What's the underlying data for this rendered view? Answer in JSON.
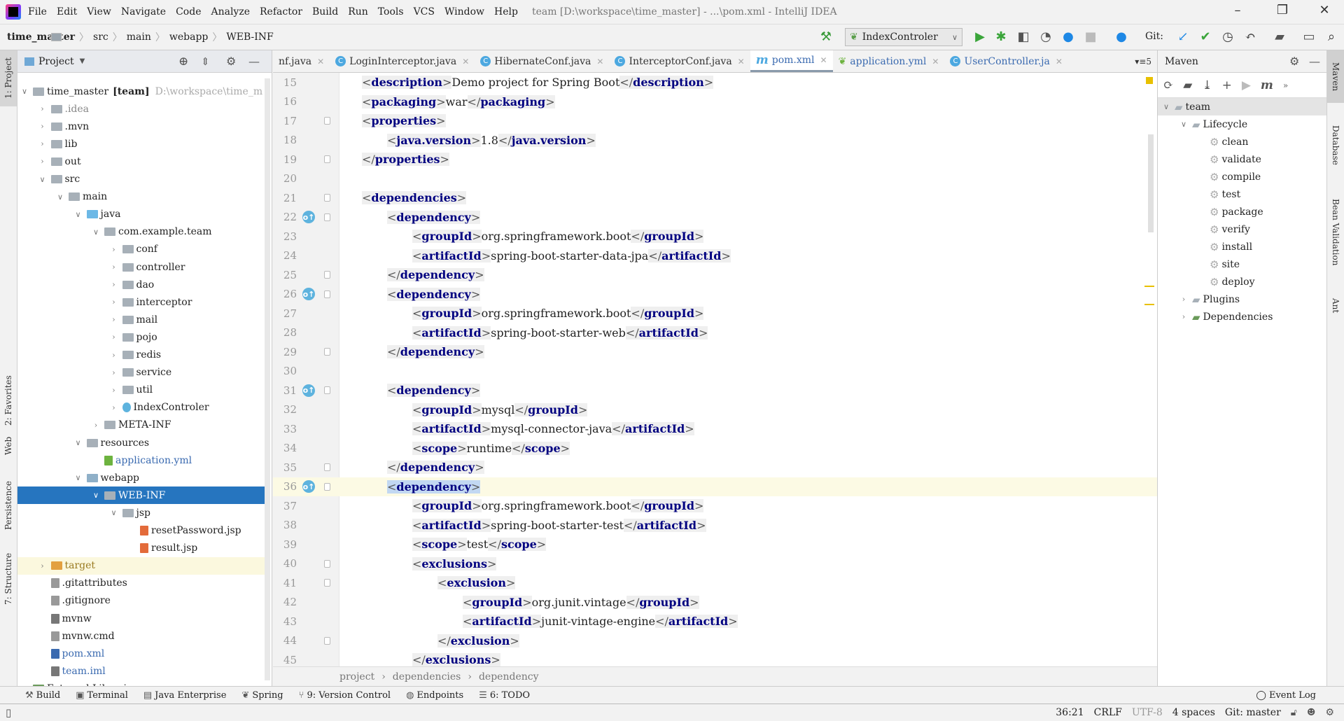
{
  "window": {
    "title": "team [D:\\workspace\\time_master] - ...\\pom.xml - IntelliJ IDEA",
    "minimize": "–",
    "restore": "❐",
    "close": "✕"
  },
  "menu": [
    "File",
    "Edit",
    "View",
    "Navigate",
    "Code",
    "Analyze",
    "Refactor",
    "Build",
    "Run",
    "Tools",
    "VCS",
    "Window",
    "Help"
  ],
  "nav": {
    "breadcrumb": [
      "time_master",
      "src",
      "main",
      "webapp",
      "WEB-INF"
    ],
    "run_config": "IndexControler",
    "git_label": "Git:"
  },
  "left_strip": [
    "1: Project",
    "2: Favorites",
    "Web",
    "Persistence",
    "7: Structure"
  ],
  "right_strip": [
    "Maven",
    "Database",
    "Bean Validation",
    "Ant"
  ],
  "project": {
    "header": "Project",
    "root_name": "time_master",
    "root_module": "[team]",
    "root_path": "D:\\workspace\\time_m",
    "items": [
      {
        "label": ".idea",
        "depth": 1,
        "exp": false,
        "icon": "folder",
        "color": "#888"
      },
      {
        "label": ".mvn",
        "depth": 1,
        "exp": false,
        "icon": "folder"
      },
      {
        "label": "lib",
        "depth": 1,
        "exp": false,
        "icon": "folder"
      },
      {
        "label": "out",
        "depth": 1,
        "exp": false,
        "icon": "folder"
      },
      {
        "label": "src",
        "depth": 1,
        "exp": true,
        "icon": "folder"
      },
      {
        "label": "main",
        "depth": 2,
        "exp": true,
        "icon": "folder"
      },
      {
        "label": "java",
        "depth": 3,
        "exp": true,
        "icon": "source-folder"
      },
      {
        "label": "com.example.team",
        "depth": 4,
        "exp": true,
        "icon": "package"
      },
      {
        "label": "conf",
        "depth": 5,
        "exp": false,
        "icon": "package"
      },
      {
        "label": "controller",
        "depth": 5,
        "exp": false,
        "icon": "package"
      },
      {
        "label": "dao",
        "depth": 5,
        "exp": false,
        "icon": "package"
      },
      {
        "label": "interceptor",
        "depth": 5,
        "exp": false,
        "icon": "package"
      },
      {
        "label": "mail",
        "depth": 5,
        "exp": false,
        "icon": "package"
      },
      {
        "label": "pojo",
        "depth": 5,
        "exp": false,
        "icon": "package"
      },
      {
        "label": "redis",
        "depth": 5,
        "exp": false,
        "icon": "package"
      },
      {
        "label": "service",
        "depth": 5,
        "exp": false,
        "icon": "package"
      },
      {
        "label": "util",
        "depth": 5,
        "exp": false,
        "icon": "package"
      },
      {
        "label": "IndexControler",
        "depth": 5,
        "exp": false,
        "icon": "spring-class"
      },
      {
        "label": "META-INF",
        "depth": 4,
        "exp": false,
        "icon": "folder"
      },
      {
        "label": "resources",
        "depth": 3,
        "exp": true,
        "icon": "resources-folder"
      },
      {
        "label": "application.yml",
        "depth": 4,
        "exp": null,
        "icon": "yml-file",
        "color": "#3a6ab0"
      },
      {
        "label": "webapp",
        "depth": 3,
        "exp": true,
        "icon": "web-folder"
      },
      {
        "label": "WEB-INF",
        "depth": 4,
        "exp": true,
        "icon": "folder",
        "state": "selected"
      },
      {
        "label": "jsp",
        "depth": 5,
        "exp": true,
        "icon": "folder"
      },
      {
        "label": "resetPassword.jsp",
        "depth": 6,
        "exp": null,
        "icon": "jsp-file"
      },
      {
        "label": "result.jsp",
        "depth": 6,
        "exp": null,
        "icon": "jsp-file"
      },
      {
        "label": "target",
        "depth": 1,
        "exp": false,
        "icon": "excluded-folder",
        "color": "#9a7a20",
        "state": "highlight"
      },
      {
        "label": ".gitattributes",
        "depth": 1,
        "exp": null,
        "icon": "file"
      },
      {
        "label": ".gitignore",
        "depth": 1,
        "exp": null,
        "icon": "file"
      },
      {
        "label": "mvnw",
        "depth": 1,
        "exp": null,
        "icon": "script-file"
      },
      {
        "label": "mvnw.cmd",
        "depth": 1,
        "exp": null,
        "icon": "file"
      },
      {
        "label": "pom.xml",
        "depth": 1,
        "exp": null,
        "icon": "maven-file",
        "color": "#3a6ab0"
      },
      {
        "label": "team.iml",
        "depth": 1,
        "exp": null,
        "icon": "iml-file",
        "color": "#3a6ab0"
      },
      {
        "label": "External Libraries",
        "depth": 0,
        "exp": false,
        "icon": "libraries"
      }
    ]
  },
  "tabs": [
    {
      "label": "nf.java",
      "icon": ""
    },
    {
      "label": "LoginInterceptor.java",
      "icon": "C"
    },
    {
      "label": "HibernateConf.java",
      "icon": "C"
    },
    {
      "label": "InterceptorConf.java",
      "icon": "C"
    },
    {
      "label": "pom.xml",
      "icon": "m",
      "active": true
    },
    {
      "label": "application.yml",
      "icon": "spring"
    },
    {
      "label": "UserController.ja",
      "icon": "C"
    }
  ],
  "tabs_overflow": "▾≡5",
  "code": [
    {
      "n": 15,
      "i": 0,
      "s": [
        [
          "t",
          "description"
        ],
        [
          "x",
          "Demo project for Spring Boot"
        ],
        [
          "c",
          "description"
        ]
      ]
    },
    {
      "n": 16,
      "i": 0,
      "s": [
        [
          "t",
          "packaging"
        ],
        [
          "x",
          "war"
        ],
        [
          "c",
          "packaging"
        ]
      ]
    },
    {
      "n": 17,
      "i": 0,
      "s": [
        [
          "t",
          "properties"
        ]
      ],
      "fold": true
    },
    {
      "n": 18,
      "i": 1,
      "s": [
        [
          "t",
          "java.version"
        ],
        [
          "x",
          "1.8"
        ],
        [
          "c",
          "java.version"
        ]
      ]
    },
    {
      "n": 19,
      "i": 0,
      "s": [
        [
          "c",
          "properties"
        ]
      ],
      "fold": true
    },
    {
      "n": 20,
      "i": 0,
      "s": []
    },
    {
      "n": 21,
      "i": 0,
      "s": [
        [
          "t",
          "dependencies"
        ]
      ],
      "fold": true
    },
    {
      "n": 22,
      "i": 1,
      "s": [
        [
          "t",
          "dependency"
        ]
      ],
      "fold": true,
      "g": true
    },
    {
      "n": 23,
      "i": 2,
      "s": [
        [
          "t",
          "groupId"
        ],
        [
          "x",
          "org.springframework.boot"
        ],
        [
          "c",
          "groupId"
        ]
      ]
    },
    {
      "n": 24,
      "i": 2,
      "s": [
        [
          "t",
          "artifactId"
        ],
        [
          "x",
          "spring-boot-starter-data-jpa"
        ],
        [
          "c",
          "artifactId"
        ]
      ]
    },
    {
      "n": 25,
      "i": 1,
      "s": [
        [
          "c",
          "dependency"
        ]
      ],
      "fold": true
    },
    {
      "n": 26,
      "i": 1,
      "s": [
        [
          "t",
          "dependency"
        ]
      ],
      "fold": true,
      "g": true
    },
    {
      "n": 27,
      "i": 2,
      "s": [
        [
          "t",
          "groupId"
        ],
        [
          "x",
          "org.springframework.boot"
        ],
        [
          "c",
          "groupId"
        ]
      ]
    },
    {
      "n": 28,
      "i": 2,
      "s": [
        [
          "t",
          "artifactId"
        ],
        [
          "x",
          "spring-boot-starter-web"
        ],
        [
          "c",
          "artifactId"
        ]
      ]
    },
    {
      "n": 29,
      "i": 1,
      "s": [
        [
          "c",
          "dependency"
        ]
      ],
      "fold": true
    },
    {
      "n": 30,
      "i": 0,
      "s": []
    },
    {
      "n": 31,
      "i": 1,
      "s": [
        [
          "t",
          "dependency"
        ]
      ],
      "fold": true,
      "g": true
    },
    {
      "n": 32,
      "i": 2,
      "s": [
        [
          "t",
          "groupId"
        ],
        [
          "x",
          "mysql"
        ],
        [
          "c",
          "groupId"
        ]
      ]
    },
    {
      "n": 33,
      "i": 2,
      "s": [
        [
          "t",
          "artifactId"
        ],
        [
          "x",
          "mysql-connector-java"
        ],
        [
          "c",
          "artifactId"
        ]
      ]
    },
    {
      "n": 34,
      "i": 2,
      "s": [
        [
          "t",
          "scope"
        ],
        [
          "x",
          "runtime"
        ],
        [
          "c",
          "scope"
        ]
      ]
    },
    {
      "n": 35,
      "i": 1,
      "s": [
        [
          "c",
          "dependency"
        ]
      ],
      "fold": true
    },
    {
      "n": 36,
      "i": 1,
      "s": [
        [
          "t",
          "dependency"
        ]
      ],
      "fold": true,
      "g": true,
      "caret": true
    },
    {
      "n": 37,
      "i": 2,
      "s": [
        [
          "t",
          "groupId"
        ],
        [
          "x",
          "org.springframework.boot"
        ],
        [
          "c",
          "groupId"
        ]
      ]
    },
    {
      "n": 38,
      "i": 2,
      "s": [
        [
          "t",
          "artifactId"
        ],
        [
          "x",
          "spring-boot-starter-test"
        ],
        [
          "c",
          "artifactId"
        ]
      ]
    },
    {
      "n": 39,
      "i": 2,
      "s": [
        [
          "t",
          "scope"
        ],
        [
          "x",
          "test"
        ],
        [
          "c",
          "scope"
        ]
      ]
    },
    {
      "n": 40,
      "i": 2,
      "s": [
        [
          "t",
          "exclusions"
        ]
      ],
      "fold": true
    },
    {
      "n": 41,
      "i": 3,
      "s": [
        [
          "t",
          "exclusion"
        ]
      ],
      "fold": true
    },
    {
      "n": 42,
      "i": 4,
      "s": [
        [
          "t",
          "groupId"
        ],
        [
          "x",
          "org.junit.vintage"
        ],
        [
          "c",
          "groupId"
        ]
      ]
    },
    {
      "n": 43,
      "i": 4,
      "s": [
        [
          "t",
          "artifactId"
        ],
        [
          "x",
          "junit-vintage-engine"
        ],
        [
          "c",
          "artifactId"
        ]
      ]
    },
    {
      "n": 44,
      "i": 3,
      "s": [
        [
          "c",
          "exclusion"
        ]
      ],
      "fold": true
    },
    {
      "n": 45,
      "i": 2,
      "s": [
        [
          "c",
          "exclusions"
        ]
      ]
    }
  ],
  "editor_breadcrumb": [
    "project",
    "dependencies",
    "dependency"
  ],
  "maven": {
    "title": "Maven",
    "root": "team",
    "lifecycle": "Lifecycle",
    "goals": [
      "clean",
      "validate",
      "compile",
      "test",
      "package",
      "verify",
      "install",
      "site",
      "deploy"
    ],
    "plugins": "Plugins",
    "dependencies": "Dependencies"
  },
  "bottom_tabs": [
    {
      "icon": "hammer-icon",
      "glyph": "⚒",
      "label": "Build"
    },
    {
      "icon": "terminal-icon",
      "glyph": "▣",
      "label": "Terminal"
    },
    {
      "icon": "java-enterprise-icon",
      "glyph": "▤",
      "label": "Java Enterprise"
    },
    {
      "icon": "spring-icon",
      "glyph": "❦",
      "label": "Spring"
    },
    {
      "icon": "version-control-icon",
      "glyph": "⑂",
      "label": "9: Version Control"
    },
    {
      "icon": "endpoints-icon",
      "glyph": "◍",
      "label": "Endpoints"
    },
    {
      "icon": "todo-icon",
      "glyph": "☰",
      "label": "6: TODO"
    }
  ],
  "event_log": "Event Log",
  "status": {
    "position": "36:21",
    "line_sep": "CRLF",
    "encoding": "UTF-8",
    "indent": "4 spaces",
    "git": "Git: master"
  },
  "colors": {
    "accent": "#2675bf",
    "tag": "#000080",
    "caret_line": "#fcfae4",
    "selection": "#2675bf"
  }
}
